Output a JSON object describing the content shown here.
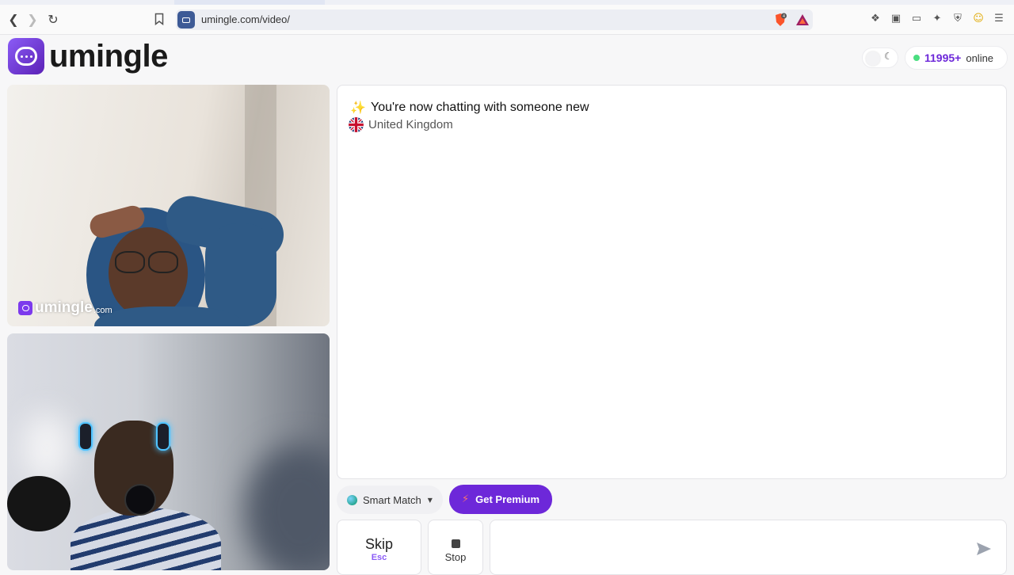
{
  "browser": {
    "url": "umingle.com/video/",
    "brave_badge": "4"
  },
  "header": {
    "logo_text": "umingle",
    "online_count": "11995+",
    "online_label": "online"
  },
  "remote_video": {
    "watermark_brand": "umingle",
    "watermark_domain": ".com"
  },
  "chat": {
    "title": "You're now chatting with someone new",
    "country": "United Kingdom"
  },
  "controls": {
    "smart_match_label": "Smart Match",
    "premium_label": "Get Premium",
    "skip_label": "Skip",
    "skip_hint": "Esc",
    "stop_label": "Stop",
    "message_placeholder": ""
  },
  "colors": {
    "brand_purple": "#6d28d9",
    "online_green": "#4ade80"
  }
}
